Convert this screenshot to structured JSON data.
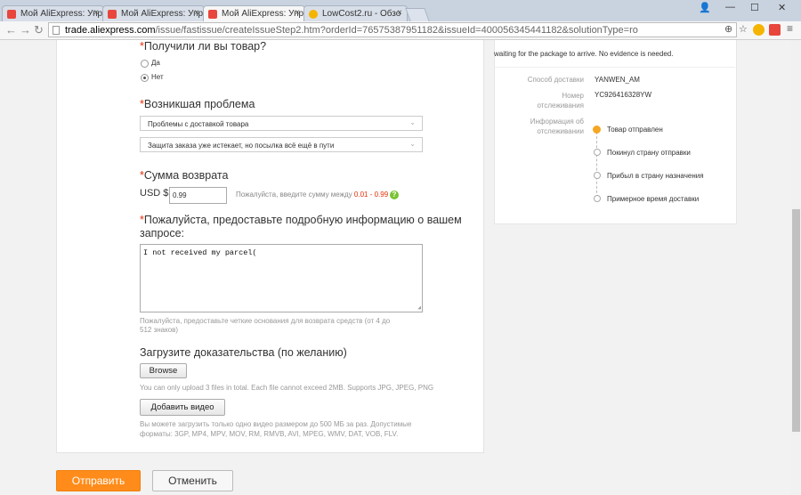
{
  "tabs": [
    {
      "title": "Мой AliExpress: Упр"
    },
    {
      "title": "Мой AliExpress: Упр"
    },
    {
      "title": "Мой AliExpress: Упр"
    },
    {
      "title": "LowCost2.ru - Обзо"
    }
  ],
  "url": {
    "domain": "trade.aliexpress.com",
    "path": "/issue/fastissue/createIssueStep2.htm?orderId=76575387951182&issueId=400056345441182&solutionType=ro"
  },
  "form": {
    "received_q": "Получили ли вы товар?",
    "yes": "Да",
    "no": "Нет",
    "problem_title": "Возникшая проблема",
    "problem_select": "Проблемы с доставкой товара",
    "problem_detail_select": "Защита заказа уже истекает, но посылка всё ещё в пути",
    "refund_title": "Сумма возврата",
    "currency": "USD $",
    "refund_value": "0.99",
    "refund_hint": "Пожалуйста, введите сумму между",
    "refund_range": "0.01 - 0.99",
    "details_title_1": "Пожалуйста, предоставьте подробную информацию о вашем",
    "details_title_2": "запросе:",
    "details_text": "I not received my parcel(",
    "details_hint_1": "Пожалуйста, предоставьте четкие основания для возврата средств (от 4 до",
    "details_hint_2": "512 знаков)",
    "upload_title": "Загрузите доказательства (по желанию)",
    "browse": "Browse",
    "upload_hint": "You can only upload 3 files in total. Each file cannot exceed 2MB. Supports JPG, JPEG, PNG",
    "add_video": "Добавить видео",
    "video_hint_1": "Вы можете загрузить только одно видео размером до 500 МБ за раз. Допустимые",
    "video_hint_2": "форматы: 3GP, MP4, MPV, MOV, RM, RMVB, AVI, MPEG, WMV, DAT, VOB, FLV."
  },
  "actions": {
    "submit": "Отправить",
    "cancel": "Отменить"
  },
  "shipping": {
    "note": "waiting for the package to arrive. No evidence is needed.",
    "method_label": "Способ доставки",
    "method_value": "YANWEN_AM",
    "tracking_label_1": "Номер",
    "tracking_label_2": "отслеживания",
    "tracking_value": "YC926416328YW",
    "info_label_1": "Информация об",
    "info_label_2": "отслеживании",
    "steps": [
      "Товар отправлен",
      "Покинул страну отправки",
      "Прибыл в страну назначения",
      "Примерное время доставки"
    ]
  },
  "colors": {
    "accent": "#ff8c1a",
    "required": "#e62e04",
    "range": "#e62e04"
  }
}
